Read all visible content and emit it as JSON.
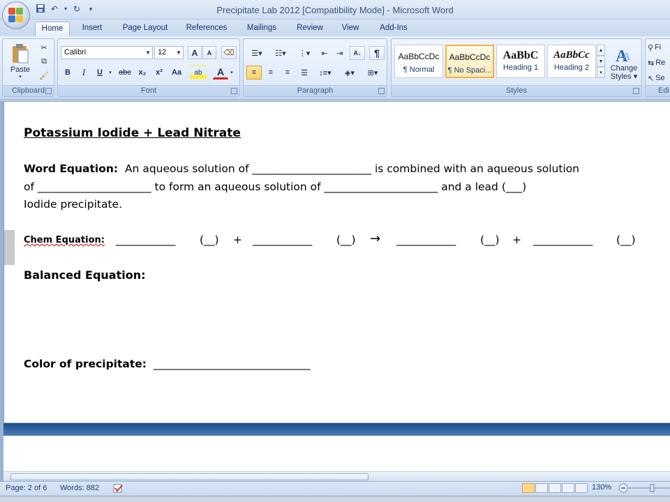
{
  "window": {
    "title": "Precipitate Lab 2012 [Compatibility Mode] - Microsoft Word",
    "qat_icons": [
      "save-icon",
      "undo-icon",
      "redo-icon",
      "customize-qat-icon"
    ]
  },
  "tabs": [
    "Home",
    "Insert",
    "Page Layout",
    "References",
    "Mailings",
    "Review",
    "View",
    "Add-Ins"
  ],
  "active_tab": "Home",
  "ribbon": {
    "clipboard": {
      "label": "Clipboard",
      "paste": "Paste"
    },
    "font": {
      "label": "Font",
      "font_name": "Calibri",
      "font_size": "12",
      "grow": "A",
      "shrink": "A",
      "bold": "B",
      "italic": "I",
      "underline": "U",
      "strike": "abc",
      "subscript": "x₂",
      "superscript": "x²",
      "change_case": "Aa",
      "highlight": "ab",
      "color": "A"
    },
    "paragraph": {
      "label": "Paragraph",
      "pilcrow": "¶"
    },
    "styles": {
      "label": "Styles",
      "items": [
        {
          "sample": "AaBbCcDc",
          "name": "¶ Normal"
        },
        {
          "sample": "AaBbCcDc",
          "name": "¶ No Spaci..."
        },
        {
          "sample": "AaBbC",
          "name": "Heading 1"
        },
        {
          "sample": "AaBbCc",
          "name": "Heading 2"
        }
      ],
      "change_styles": "Change Styles",
      "change_styles_line1": "Change",
      "change_styles_line2": "Styles ▾"
    },
    "editing": {
      "label": "Edi",
      "find": "Fi",
      "replace": "Re",
      "select": "Se"
    }
  },
  "document": {
    "title": "Potassium Iodide + Lead Nitrate",
    "word_eq_label": "Word Equation:",
    "word_eq_line1": "An aqueous solution of ______________________  is combined with an aqueous solution",
    "word_eq_line2": "of _____________________  to form an aqueous solution of _____________________  and a lead (___)",
    "word_eq_line3": "Iodide precipitate.",
    "chem_label": "Chem Equation:",
    "chem_blank": "___________",
    "chem_state": "(__)",
    "plus": "+",
    "arrow": "→",
    "balanced_label": "Balanced Equation:",
    "color_label": "Color of precipitate:",
    "color_blank": "_____________________________"
  },
  "status": {
    "page": "Page: 2 of 6",
    "words": "Words: 882",
    "zoom": "130%"
  },
  "colors": {
    "ribbon_bg": "#dbe8f7",
    "doc_bg": "#9bb3d3",
    "selected_style": "#ffeab8"
  }
}
